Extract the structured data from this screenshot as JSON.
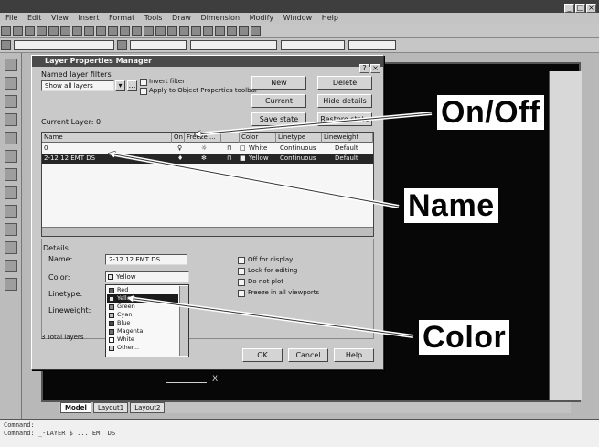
{
  "app": {
    "menu": [
      "File",
      "Edit",
      "View",
      "Insert",
      "Format",
      "Tools",
      "Draw",
      "Dimension",
      "Modify",
      "Window",
      "Help"
    ]
  },
  "dialog": {
    "title": "Layer Properties Manager",
    "named_layer_filters_label": "Named layer filters",
    "filter_value": "Show all layers",
    "invert_filter_label": "Invert filter",
    "apply_toolbar_label": "Apply to Object Properties toolbar",
    "buttons": {
      "new": "New",
      "delete": "Delete",
      "current": "Current",
      "hide_details": "Hide details",
      "save_state": "Save state",
      "restore_state": "Restore state",
      "ok": "OK",
      "cancel": "Cancel",
      "help": "Help"
    },
    "current_layer_label": "Current Layer: 0",
    "columns": [
      "Name",
      "On",
      "Freeze ...",
      "",
      "Color",
      "Linetype",
      "Lineweight"
    ],
    "rows": [
      {
        "name": "0",
        "color": "White",
        "linetype": "Continuous",
        "lineweight": "Default"
      },
      {
        "name": "2-12 12 EMT DS",
        "color": "Yellow",
        "linetype": "Continuous",
        "lineweight": "Default"
      }
    ],
    "details_label": "Details",
    "details_name_label": "Name:",
    "details_name_value": "2-12 12 EMT DS",
    "details_color_label": "Color:",
    "details_color_value": "Yellow",
    "details_linetype_label": "Linetype:",
    "details_lineweight_label": "Lineweight:",
    "checkboxes": [
      "Off for display",
      "Lock for editing",
      "Do not plot",
      "Freeze in all viewports"
    ],
    "total_layers_label": "3 Total layers",
    "color_options": [
      {
        "name": "Red",
        "swatch": "#5c5c5c"
      },
      {
        "name": "Yellow",
        "swatch": "#e6e6e6"
      },
      {
        "name": "Green",
        "swatch": "#8a8a8a"
      },
      {
        "name": "Cyan",
        "swatch": "#bdbdbd"
      },
      {
        "name": "Blue",
        "swatch": "#4a4a4a"
      },
      {
        "name": "Magenta",
        "swatch": "#6e6e6e"
      },
      {
        "name": "White",
        "swatch": "#ffffff"
      },
      {
        "name": "Other...",
        "swatch": "#c8c8c8"
      }
    ],
    "selected_color_index": 1
  },
  "drawing": {
    "tabs": [
      "Model",
      "Layout1",
      "Layout2"
    ],
    "axis_label": "X"
  },
  "command_line": {
    "lines": [
      "Command:",
      "Command: _-LAYER  $  ... EMT DS"
    ]
  },
  "callouts": {
    "on_off": "On/Off",
    "name": "Name",
    "color": "Color"
  }
}
